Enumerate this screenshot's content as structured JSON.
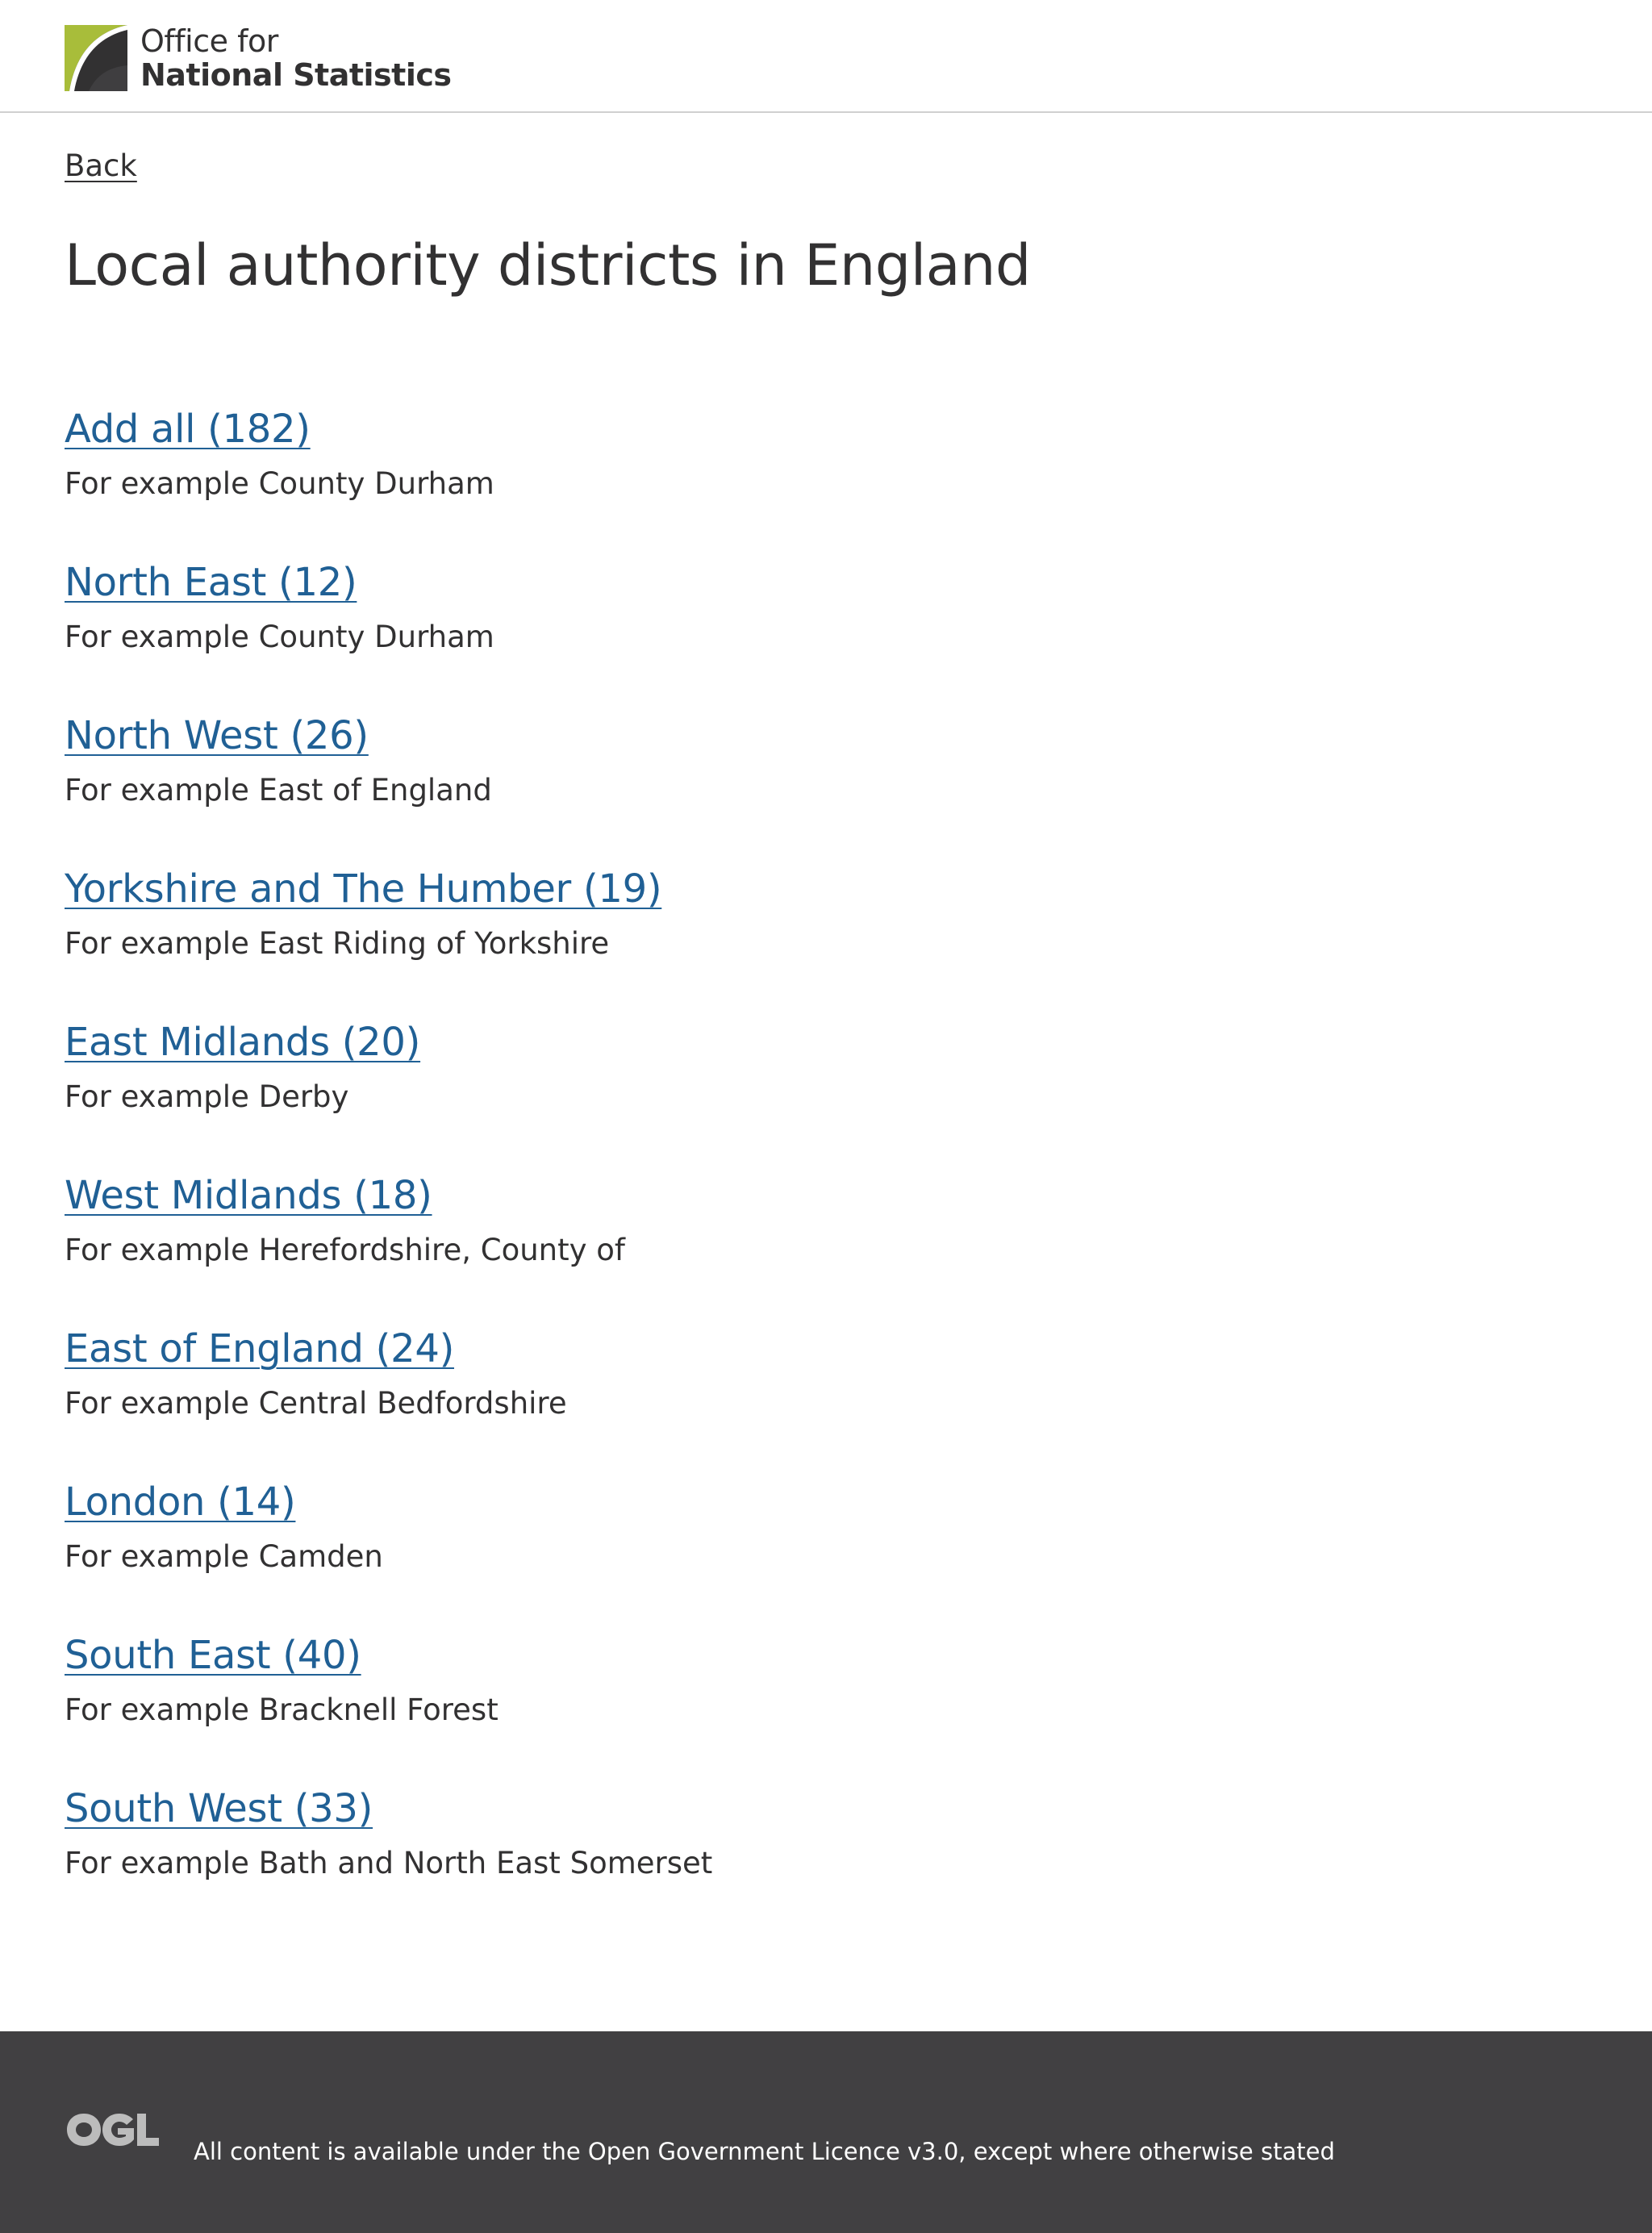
{
  "header": {
    "logo_line1": "Office for",
    "logo_line2": "National Statistics"
  },
  "nav": {
    "back_label": "Back"
  },
  "page_title": "Local authority districts in England",
  "colors": {
    "link": "#206095",
    "text": "#323132",
    "footer_bg": "#414042",
    "logo_green": "#a8bd3a"
  },
  "regions": [
    {
      "label": "Add all (182)",
      "hint": "For example County Durham"
    },
    {
      "label": "North East (12)",
      "hint": "For example County Durham"
    },
    {
      "label": "North West (26)",
      "hint": "For example East of England"
    },
    {
      "label": "Yorkshire and The Humber (19)",
      "hint": "For example East Riding of Yorkshire"
    },
    {
      "label": "East Midlands (20)",
      "hint": "For example Derby"
    },
    {
      "label": "West Midlands (18)",
      "hint": "For example Herefordshire, County of"
    },
    {
      "label": "East of England (24)",
      "hint": "For example Central Bedfordshire"
    },
    {
      "label": "London (14)",
      "hint": "For example Camden"
    },
    {
      "label": "South East (40)",
      "hint": "For example Bracknell Forest"
    },
    {
      "label": "South West (33)",
      "hint": "For example Bath and North East Somerset"
    }
  ],
  "footer": {
    "licence_text": "All content is available under the Open Government Licence v3.0, except where otherwise stated",
    "ogl_icon": "ogl-logo"
  }
}
